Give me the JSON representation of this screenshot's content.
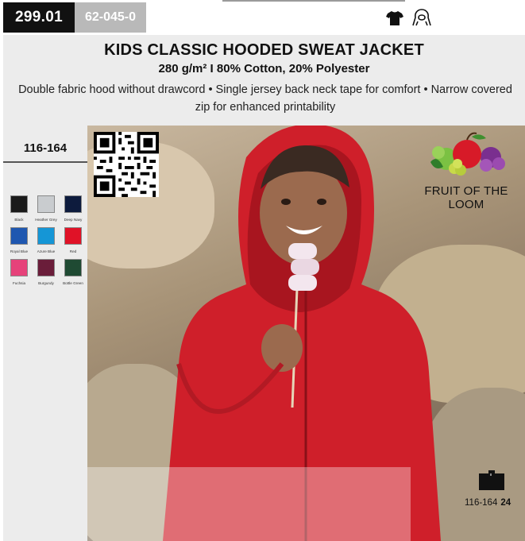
{
  "product": {
    "code": "299.01",
    "sku": "62-045-0",
    "title": "KIDS CLASSIC HOODED SWEAT JACKET",
    "subtitle": "280 g/m² I 80% Cotton, 20% Polyester",
    "description": "Double fabric hood without drawcord • Single jersey back neck tape for comfort • Narrow covered zip for enhanced printability"
  },
  "icons": [
    "tshirt-icon",
    "hood-icon"
  ],
  "sizes": {
    "range": "116-164"
  },
  "colors": [
    {
      "name": "Black",
      "hex": "#1a1a1a"
    },
    {
      "name": "Heather Grey",
      "hex": "#c9cccf"
    },
    {
      "name": "Deep Navy",
      "hex": "#0d1b3d"
    },
    {
      "name": "Royal Blue",
      "hex": "#1f57b0"
    },
    {
      "name": "Azure Blue",
      "hex": "#1596d6"
    },
    {
      "name": "Red",
      "hex": "#e01227"
    },
    {
      "name": "Fuchsia",
      "hex": "#e6427a"
    },
    {
      "name": "Burgundy",
      "hex": "#6a1d3a"
    },
    {
      "name": "Bottle Green",
      "hex": "#1f4a33"
    }
  ],
  "brand": {
    "name": "FRUIT OF THE LOOM"
  },
  "packaging": {
    "size_range": "116-164",
    "qty": "24"
  }
}
